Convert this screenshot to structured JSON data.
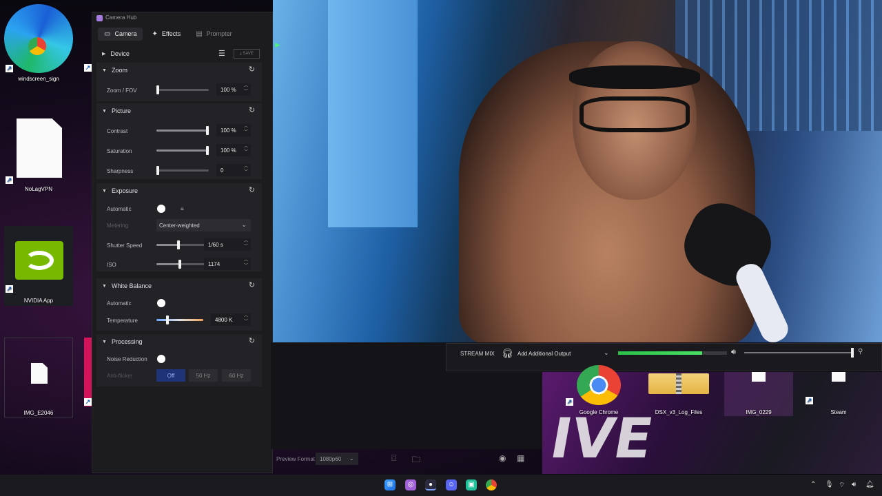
{
  "desktop": {
    "icons": [
      {
        "label": "windscreen_sign"
      },
      {
        "label": "NoLagVPN"
      },
      {
        "label": "NVIDIA App"
      },
      {
        "label": "IMG_E2046"
      },
      {
        "label": "Google Chrome"
      },
      {
        "label": "DSX_v3_Log_Files"
      },
      {
        "label": "IMG_0229"
      },
      {
        "label": "Steam"
      }
    ]
  },
  "camera_hub": {
    "title": "Camera Hub",
    "tabs": [
      {
        "label": "Camera",
        "icon": "camera-icon",
        "active": true
      },
      {
        "label": "Effects",
        "icon": "magic-wand-icon",
        "active": false
      },
      {
        "label": "Prompter",
        "icon": "prompter-icon",
        "active": false
      }
    ],
    "device": {
      "label": "Device",
      "save_label": "SAVE"
    },
    "zoom": {
      "label": "Zoom",
      "rows": [
        {
          "label": "Zoom / FOV",
          "value": "100 %",
          "level": 0.0
        }
      ]
    },
    "picture": {
      "label": "Picture",
      "rows": [
        {
          "label": "Contrast",
          "value": "100 %",
          "level": 1.0
        },
        {
          "label": "Saturation",
          "value": "100 %",
          "level": 1.0
        },
        {
          "label": "Sharpness",
          "value": "0",
          "level": 0.0
        }
      ]
    },
    "exposure": {
      "label": "Exposure",
      "automatic_label": "Automatic",
      "metering_label": "Metering",
      "metering_value": "Center-weighted",
      "shutter_label": "Shutter Speed",
      "shutter_value": "1/60 s",
      "shutter_level": 0.41,
      "iso_label": "ISO",
      "iso_value": "1174",
      "iso_level": 0.45
    },
    "white_balance": {
      "label": "White Balance",
      "automatic_label": "Automatic",
      "temperature_label": "Temperature",
      "temperature_value": "4800 K",
      "temperature_level": 0.22
    },
    "processing": {
      "label": "Processing",
      "noise_label": "Noise Reduction",
      "antiflicker_label": "Anti-flicker",
      "antiflicker_options": [
        "Off",
        "50 Hz",
        "60 Hz"
      ],
      "antiflicker_selected": "Off"
    }
  },
  "stream_mix": {
    "label": "STREAM MIX",
    "output_label": "Add Additional Output",
    "meter_level": 0.77,
    "volume_level": 0.98
  },
  "preview": {
    "format_label": "Preview Format",
    "format_value": "1080p60"
  },
  "colors": {
    "accent_green": "#2cc24a",
    "segment_selected": "#1e3476",
    "panel_bg": "#1c1c1f"
  }
}
